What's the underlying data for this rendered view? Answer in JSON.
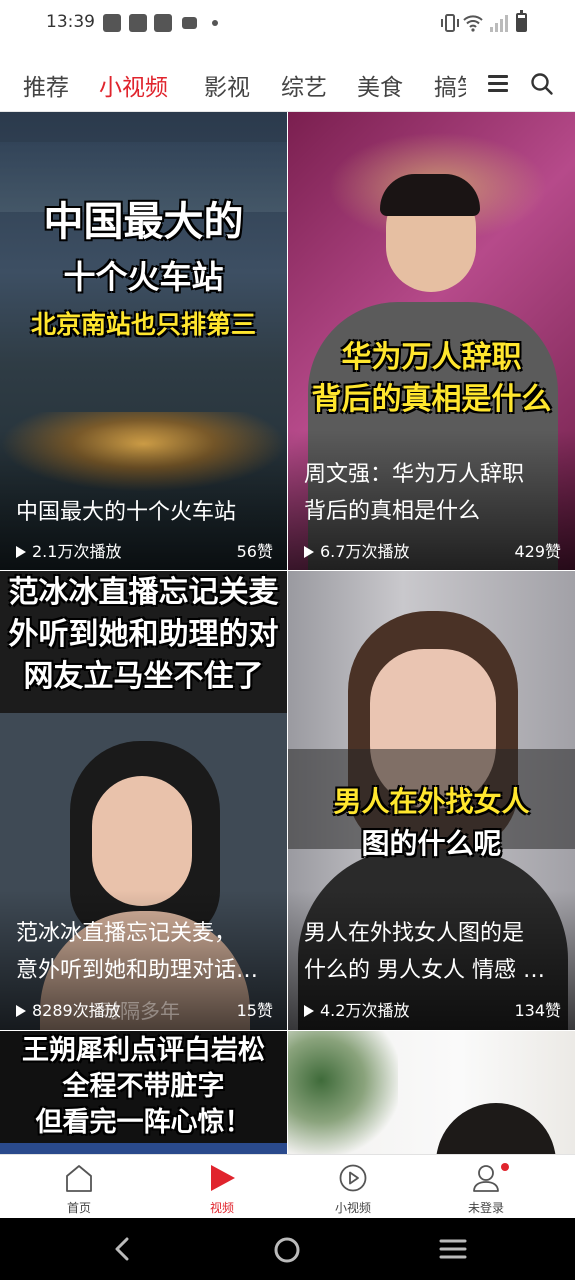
{
  "status_bar": {
    "time": "13:39",
    "notification_icons": [
      "message-icon",
      "message-icon",
      "message-icon",
      "video-icon"
    ],
    "right_icons": [
      "vibrate-icon",
      "wifi-icon",
      "signal-icon",
      "battery-icon"
    ]
  },
  "tabs": {
    "items": [
      {
        "label": "推荐",
        "active": false
      },
      {
        "label": "小视频",
        "active": true
      },
      {
        "label": "影视",
        "active": false
      },
      {
        "label": "综艺",
        "active": false
      },
      {
        "label": "美食",
        "active": false
      },
      {
        "label": "搞笑",
        "active": false
      }
    ],
    "active_color": "#e0242d"
  },
  "feed": {
    "cards": [
      {
        "caption_lines": [
          "中国最大的",
          "十个火车站",
          "北京南站也只排第三"
        ],
        "title_lines": [
          "中国最大的十个火车站"
        ],
        "plays": "2.1万次播放",
        "likes": "56赞"
      },
      {
        "caption_lines": [
          "华为万人辞职",
          "背后的真相是什么"
        ],
        "title_lines": [
          "周文强：华为万人辞职",
          "背后的真相是什么"
        ],
        "plays": "6.7万次播放",
        "likes": "429赞"
      },
      {
        "caption_lines": [
          "范冰冰直播忘记关麦",
          "外听到她和助理的对",
          "网友立马坐不住了"
        ],
        "title_lines": [
          "范冰冰直播忘记关麦，",
          "意外听到她和助理对话…"
        ],
        "overlay_text": "时隔多年",
        "plays": "8289次播放",
        "likes": "15赞"
      },
      {
        "caption_lines": [
          "男人在外找女人",
          "图的什么呢"
        ],
        "title_lines": [
          "男人在外找女人图的是",
          "什么的 男人女人  情感 …"
        ],
        "plays": "4.2万次播放",
        "likes": "134赞"
      },
      {
        "caption_lines": [
          "王朔犀利点评白岩松",
          "全程不带脏字",
          "但看完一阵心惊！"
        ]
      },
      {
        "caption_lines": []
      }
    ]
  },
  "bottom_nav": {
    "items": [
      {
        "label": "首页",
        "icon": "home-icon",
        "active": false
      },
      {
        "label": "视频",
        "icon": "video-play-icon",
        "active": true
      },
      {
        "label": "小视频",
        "icon": "short-video-icon",
        "active": false
      },
      {
        "label": "未登录",
        "icon": "user-icon",
        "active": false,
        "badge": true
      }
    ]
  },
  "system_nav": {
    "buttons": [
      "back-icon",
      "home-circle-icon",
      "recents-icon"
    ]
  }
}
